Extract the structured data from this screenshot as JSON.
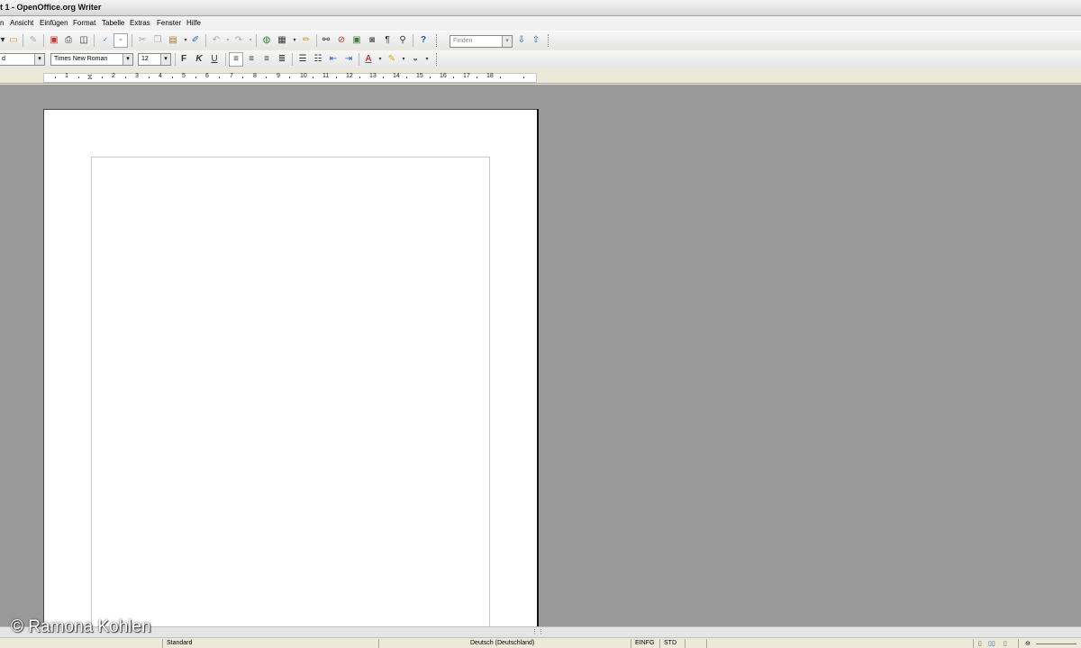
{
  "window": {
    "title": "t 1 - OpenOffice.org Writer"
  },
  "menu": {
    "items": [
      "n",
      "Ansicht",
      "Einfügen",
      "Format",
      "Tabelle",
      "Extras",
      "Fenster",
      "Hilfe"
    ]
  },
  "toolbar1": {
    "icons": [
      "new-doc-icon",
      "open-icon",
      "edit-mode-icon",
      "export-pdf-icon",
      "print-icon",
      "page-preview-icon",
      "spellcheck-icon",
      "autospellcheck-icon",
      "cut-icon",
      "copy-icon",
      "paste-icon",
      "paintbrush-icon",
      "undo-icon",
      "redo-icon",
      "hyperlink-icon",
      "table-icon",
      "draw-functions-icon",
      "navigator-icon",
      "gallery-icon",
      "data-sources-icon",
      "formatting-marks-icon",
      "zoom-icon",
      "help-icon"
    ],
    "find": {
      "placeholder": "Finden"
    }
  },
  "toolbar2": {
    "style_value": "d",
    "font_name": "Times New Roman",
    "font_size": "12",
    "bold_label": "F",
    "italic_label": "K",
    "underline_label": "U"
  },
  "ruler": {
    "labels": [
      "1",
      "2",
      "3",
      "4",
      "5",
      "6",
      "7",
      "8",
      "9",
      "10",
      "11",
      "12",
      "13",
      "14",
      "15",
      "16",
      "17",
      "18"
    ]
  },
  "statusbar": {
    "page_style": "Standard",
    "language": "Deutsch (Deutschland)",
    "insert_mode": "EINFG",
    "selection_mode": "STD"
  },
  "watermark": "© Ramona Kohlen"
}
